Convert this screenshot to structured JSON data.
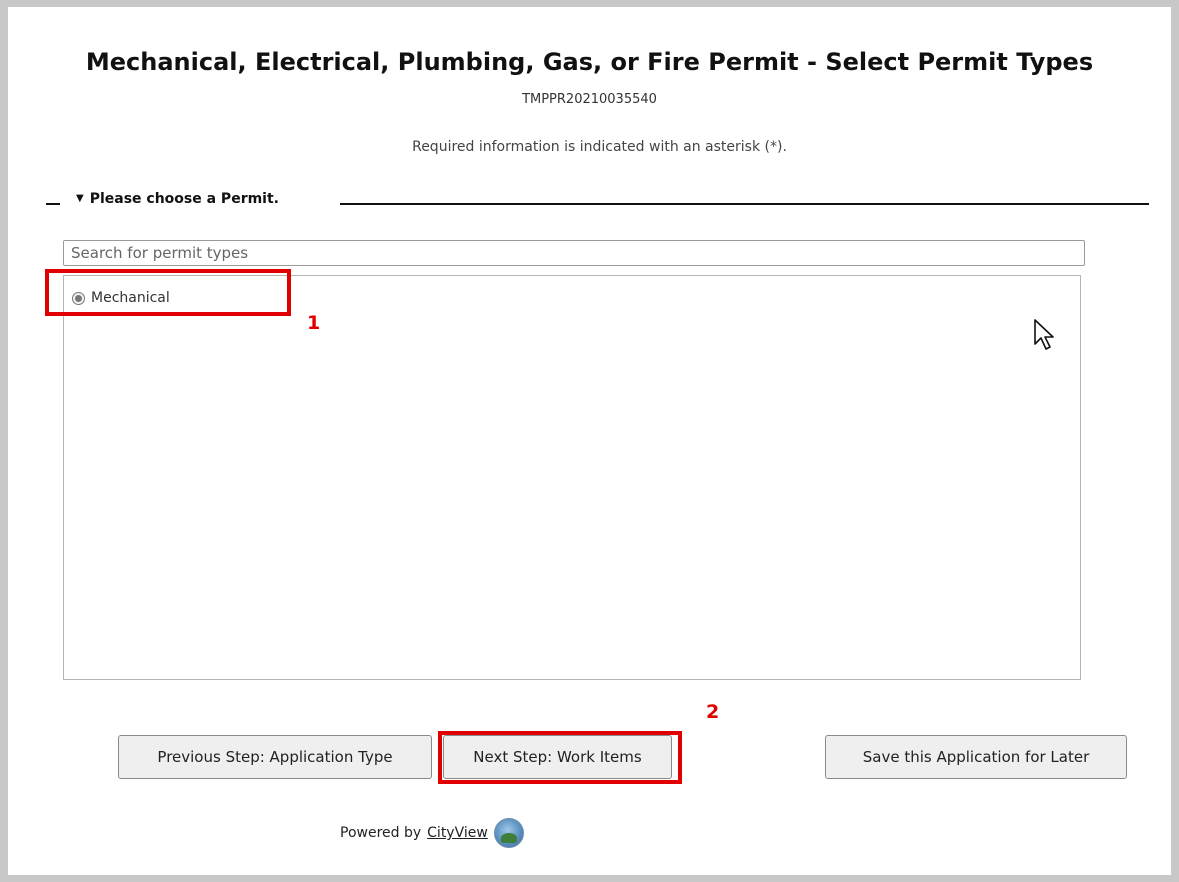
{
  "header": {
    "title": "Mechanical, Electrical, Plumbing, Gas, or Fire Permit - Select Permit Types",
    "application_id": "TMPPR20210035540",
    "required_note": "Required information is indicated with an asterisk (*)."
  },
  "section": {
    "label": "Please choose a Permit."
  },
  "search": {
    "placeholder": "Search for permit types",
    "value": ""
  },
  "permit_options": [
    {
      "label": "Mechanical",
      "selected": true
    }
  ],
  "annotations": {
    "callout_1": "1",
    "callout_2": "2",
    "color": "#e00000"
  },
  "buttons": {
    "previous": "Previous Step: Application Type",
    "next": "Next Step: Work Items",
    "save_later": "Save this Application for Later"
  },
  "footer": {
    "powered_by": "Powered by",
    "brand": "CityView"
  }
}
